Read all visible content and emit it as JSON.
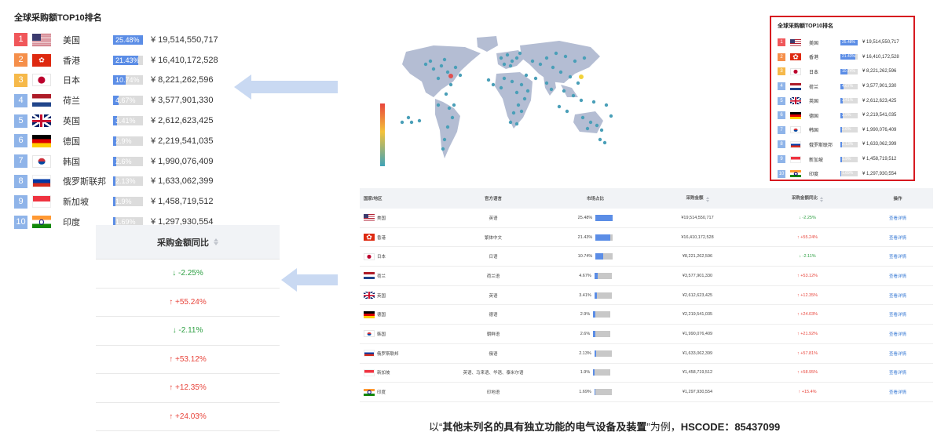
{
  "ranking": {
    "title": "全球采购额TOP10排名",
    "rows": [
      {
        "rank": "1",
        "country": "美国",
        "flag": "us-flag",
        "share": "25.48%",
        "amount": "¥ 19,514,550,717",
        "rank_color": "#f0575a",
        "share_value": 25.48
      },
      {
        "rank": "2",
        "country": "香港",
        "flag": "hk-flag",
        "share": "21.43%",
        "amount": "¥ 16,410,172,528",
        "rank_color": "#f58f4a",
        "share_value": 21.43
      },
      {
        "rank": "3",
        "country": "日本",
        "flag": "jp-flag",
        "share": "10.74%",
        "amount": "¥ 8,221,262,596",
        "rank_color": "#f6b94a",
        "share_value": 10.74
      },
      {
        "rank": "4",
        "country": "荷兰",
        "flag": "nl-flag",
        "share": "4.67%",
        "amount": "¥ 3,577,901,330",
        "rank_color": "#8fb4e9",
        "share_value": 4.67
      },
      {
        "rank": "5",
        "country": "英国",
        "flag": "gb-flag",
        "share": "3.41%",
        "amount": "¥ 2,612,623,425",
        "rank_color": "#8fb4e9",
        "share_value": 3.41
      },
      {
        "rank": "6",
        "country": "德国",
        "flag": "de-flag",
        "share": "2.9%",
        "amount": "¥ 2,219,541,035",
        "rank_color": "#8fb4e9",
        "share_value": 2.9
      },
      {
        "rank": "7",
        "country": "韩国",
        "flag": "kr-flag",
        "share": "2.6%",
        "amount": "¥ 1,990,076,409",
        "rank_color": "#8fb4e9",
        "share_value": 2.6
      },
      {
        "rank": "8",
        "country": "俄罗斯联邦",
        "flag": "ru-flag",
        "share": "2.13%",
        "amount": "¥ 1,633,062,399",
        "rank_color": "#8fb4e9",
        "share_value": 2.13
      },
      {
        "rank": "9",
        "country": "新加坡",
        "flag": "sg-flag",
        "share": "1.9%",
        "amount": "¥ 1,458,719,512",
        "rank_color": "#8fb4e9",
        "share_value": 1.9
      },
      {
        "rank": "10",
        "country": "印度",
        "flag": "in-flag",
        "share": "1.69%",
        "amount": "¥ 1,297,930,554",
        "rank_color": "#8fb4e9",
        "share_value": 1.69
      }
    ]
  },
  "yoy_column": {
    "header": "采购金额同比",
    "values": [
      {
        "text": "↓ -2.25%",
        "dir": "down"
      },
      {
        "text": "↑ +55.24%",
        "dir": "up"
      },
      {
        "text": "↓ -2.11%",
        "dir": "down"
      },
      {
        "text": "↑ +53.12%",
        "dir": "up"
      },
      {
        "text": "↑ +12.35%",
        "dir": "up"
      },
      {
        "text": "↑ +24.03%",
        "dir": "up"
      }
    ]
  },
  "table": {
    "headers": [
      "国家/地区",
      "官方语言",
      "市场占比",
      "采购金额",
      "采购金额同比",
      "操作"
    ],
    "rows": [
      {
        "country": "美国",
        "flag": "us-flag",
        "language": "英语",
        "share": "25.48%",
        "share_value": 25.48,
        "amount": "¥19,514,550,717",
        "yoy": "↓ -2.25%",
        "dir": "down",
        "action": "查看详情"
      },
      {
        "country": "香港",
        "flag": "hk-flag",
        "language": "繁体中文",
        "share": "21.43%",
        "share_value": 21.43,
        "amount": "¥16,410,172,528",
        "yoy": "↑ +55.24%",
        "dir": "up",
        "action": "查看详情"
      },
      {
        "country": "日本",
        "flag": "jp-flag",
        "language": "日语",
        "share": "10.74%",
        "share_value": 10.74,
        "amount": "¥8,221,262,596",
        "yoy": "↓ -2.11%",
        "dir": "down",
        "action": "查看详情"
      },
      {
        "country": "荷兰",
        "flag": "nl-flag",
        "language": "荷兰语",
        "share": "4.67%",
        "share_value": 4.67,
        "amount": "¥3,577,901,330",
        "yoy": "↑ +53.12%",
        "dir": "up",
        "action": "查看详情"
      },
      {
        "country": "英国",
        "flag": "gb-flag",
        "language": "英语",
        "share": "3.41%",
        "share_value": 3.41,
        "amount": "¥2,612,623,425",
        "yoy": "↑ +12.35%",
        "dir": "up",
        "action": "查看详情"
      },
      {
        "country": "德国",
        "flag": "de-flag",
        "language": "德语",
        "share": "2.9%",
        "share_value": 2.9,
        "amount": "¥2,219,541,035",
        "yoy": "↑ +24.03%",
        "dir": "up",
        "action": "查看详情"
      },
      {
        "country": "韩国",
        "flag": "kr-flag",
        "language": "朝鲜语",
        "share": "2.6%",
        "share_value": 2.6,
        "amount": "¥1,990,076,409",
        "yoy": "↑ +21.92%",
        "dir": "up",
        "action": "查看详情"
      },
      {
        "country": "俄罗斯联邦",
        "flag": "ru-flag",
        "language": "俄语",
        "share": "2.13%",
        "share_value": 2.13,
        "amount": "¥1,633,062,399",
        "yoy": "↑ +57.81%",
        "dir": "up",
        "action": "查看详情"
      },
      {
        "country": "新加坡",
        "flag": "sg-flag",
        "language": "英语、马来语、华语、泰米尔语",
        "share": "1.9%",
        "share_value": 1.9,
        "amount": "¥1,458,719,512",
        "yoy": "↑ +58.95%",
        "dir": "up",
        "action": "查看详情"
      },
      {
        "country": "印度",
        "flag": "in-flag",
        "language": "印地语",
        "share": "1.69%",
        "share_value": 1.69,
        "amount": "¥1,297,930,554",
        "yoy": "↑ +15.4%",
        "dir": "up",
        "action": "查看详情"
      }
    ]
  },
  "caption": {
    "prefix": "以“",
    "product": "其他未列名的具有独立功能的电气设备及装置",
    "suffix": "”为例，",
    "code_label": "HSCODE：",
    "code": "85437099"
  },
  "colors": {
    "bar_fill": "#5b8de6",
    "up": "#e8453c",
    "down": "#2ea043",
    "highlight_box": "#d71920",
    "arrow": "#c9d9f2",
    "map_land": "#b4bdd3",
    "map_dot": "#4a9fb8"
  }
}
